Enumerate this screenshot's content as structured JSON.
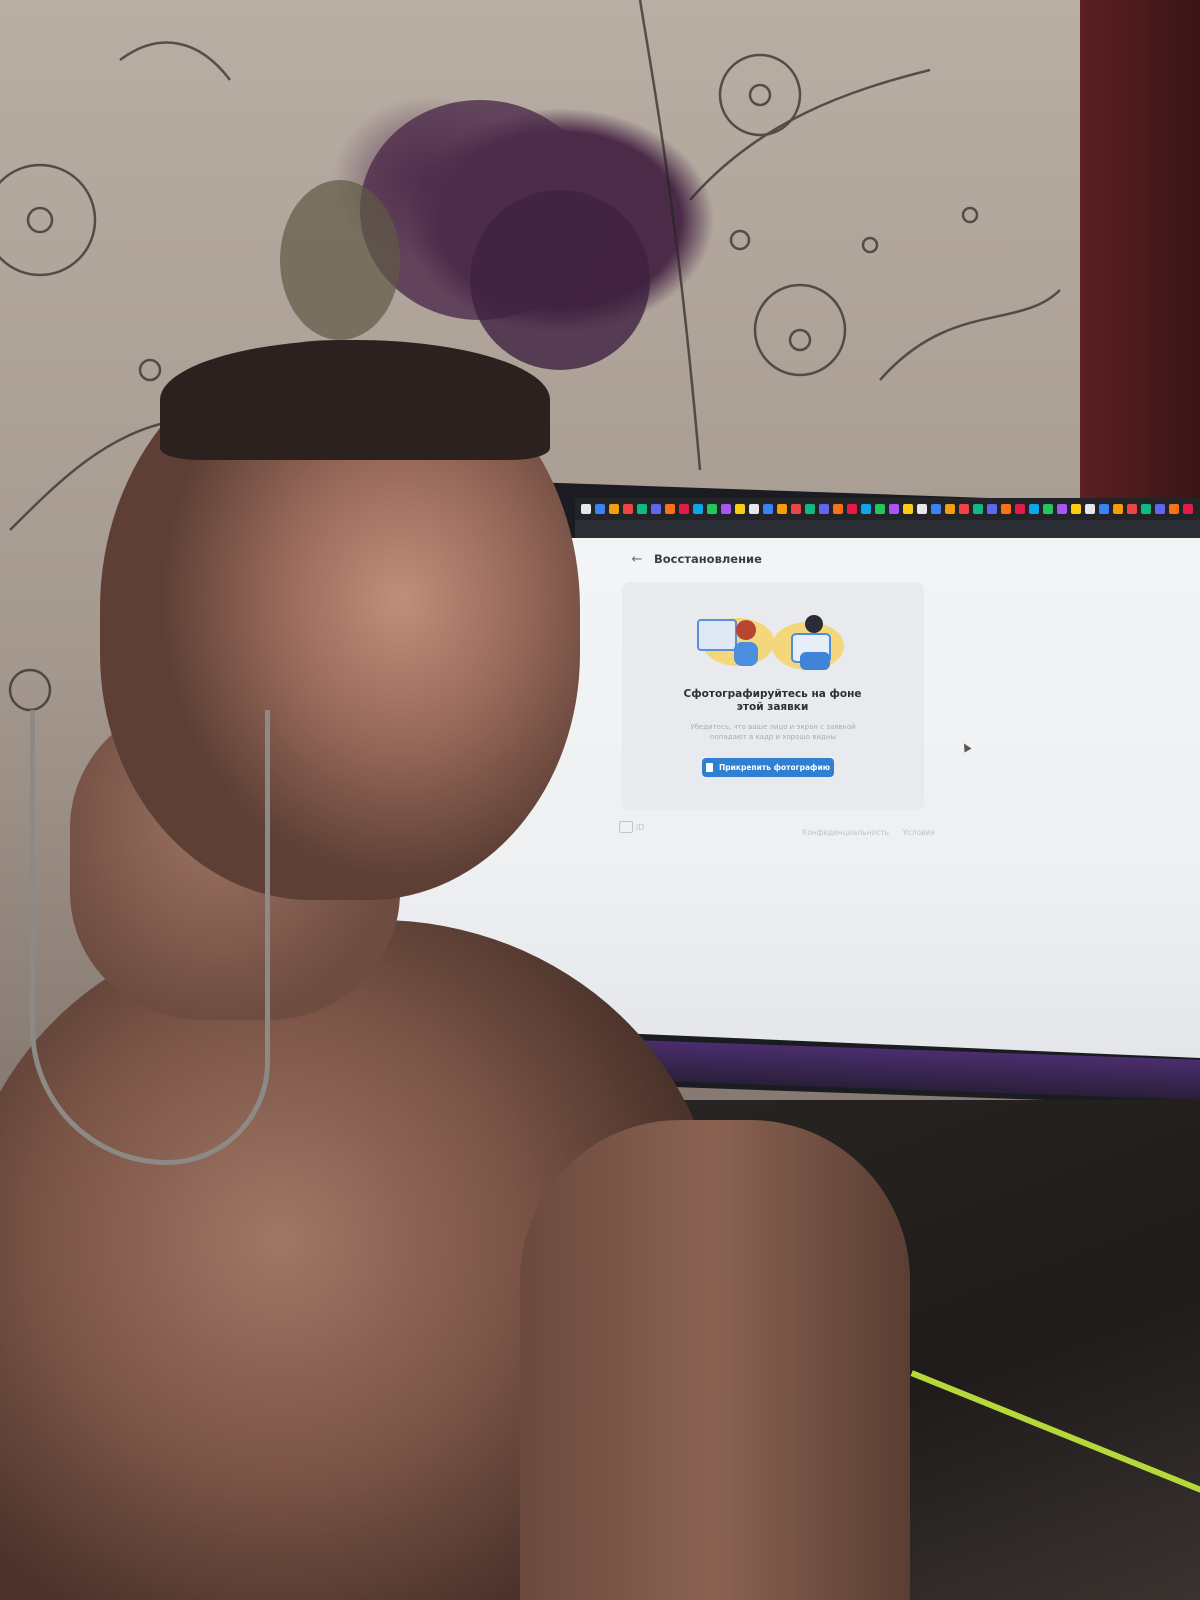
{
  "screen": {
    "page_title": "Восстановление",
    "card": {
      "title": "Сфотографируйтесь на фоне этой заявки",
      "description": "Убедитесь, что ваше лицо и экран с заявкой попадают в кадр и хорошо видны",
      "attach_button_label": "Прикрепить фотографию"
    },
    "footer": {
      "logo_text": "ID",
      "links": [
        "Конфиденциальность",
        "Условия"
      ]
    },
    "tab_colors": [
      "#e5e7eb",
      "#3b82f6",
      "#f59e0b",
      "#ef4444",
      "#10b981",
      "#6366f1",
      "#f97316",
      "#e11d48",
      "#0ea5e9",
      "#22c55e",
      "#a855f7",
      "#facc15"
    ],
    "accent_color": "#2f7fd2"
  }
}
